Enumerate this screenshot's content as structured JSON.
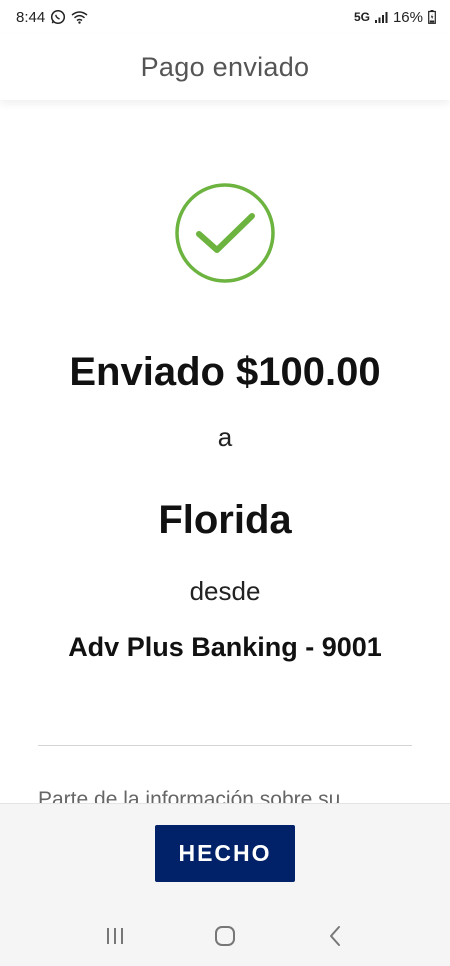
{
  "status_bar": {
    "time": "8:44",
    "network": "5G",
    "battery": "16%",
    "icons": [
      "whatsapp-icon",
      "wifi-icon",
      "signal-icon",
      "battery-icon"
    ]
  },
  "header": {
    "title": "Pago enviado"
  },
  "confirmation": {
    "icon": "checkmark-circle-icon",
    "amount_line": "Enviado $100.00",
    "to_word": "a",
    "recipient": "Florida",
    "from_word": "desde",
    "account": "Adv Plus Banking - 9001",
    "info_text": "Parte de la información sobre su"
  },
  "actions": {
    "done_label": "HECHO"
  },
  "nav_bar": {
    "icons": [
      "recent-apps-icon",
      "home-icon",
      "back-icon"
    ]
  },
  "colors": {
    "accent_green": "#6CB33F",
    "button_navy": "#012169"
  }
}
